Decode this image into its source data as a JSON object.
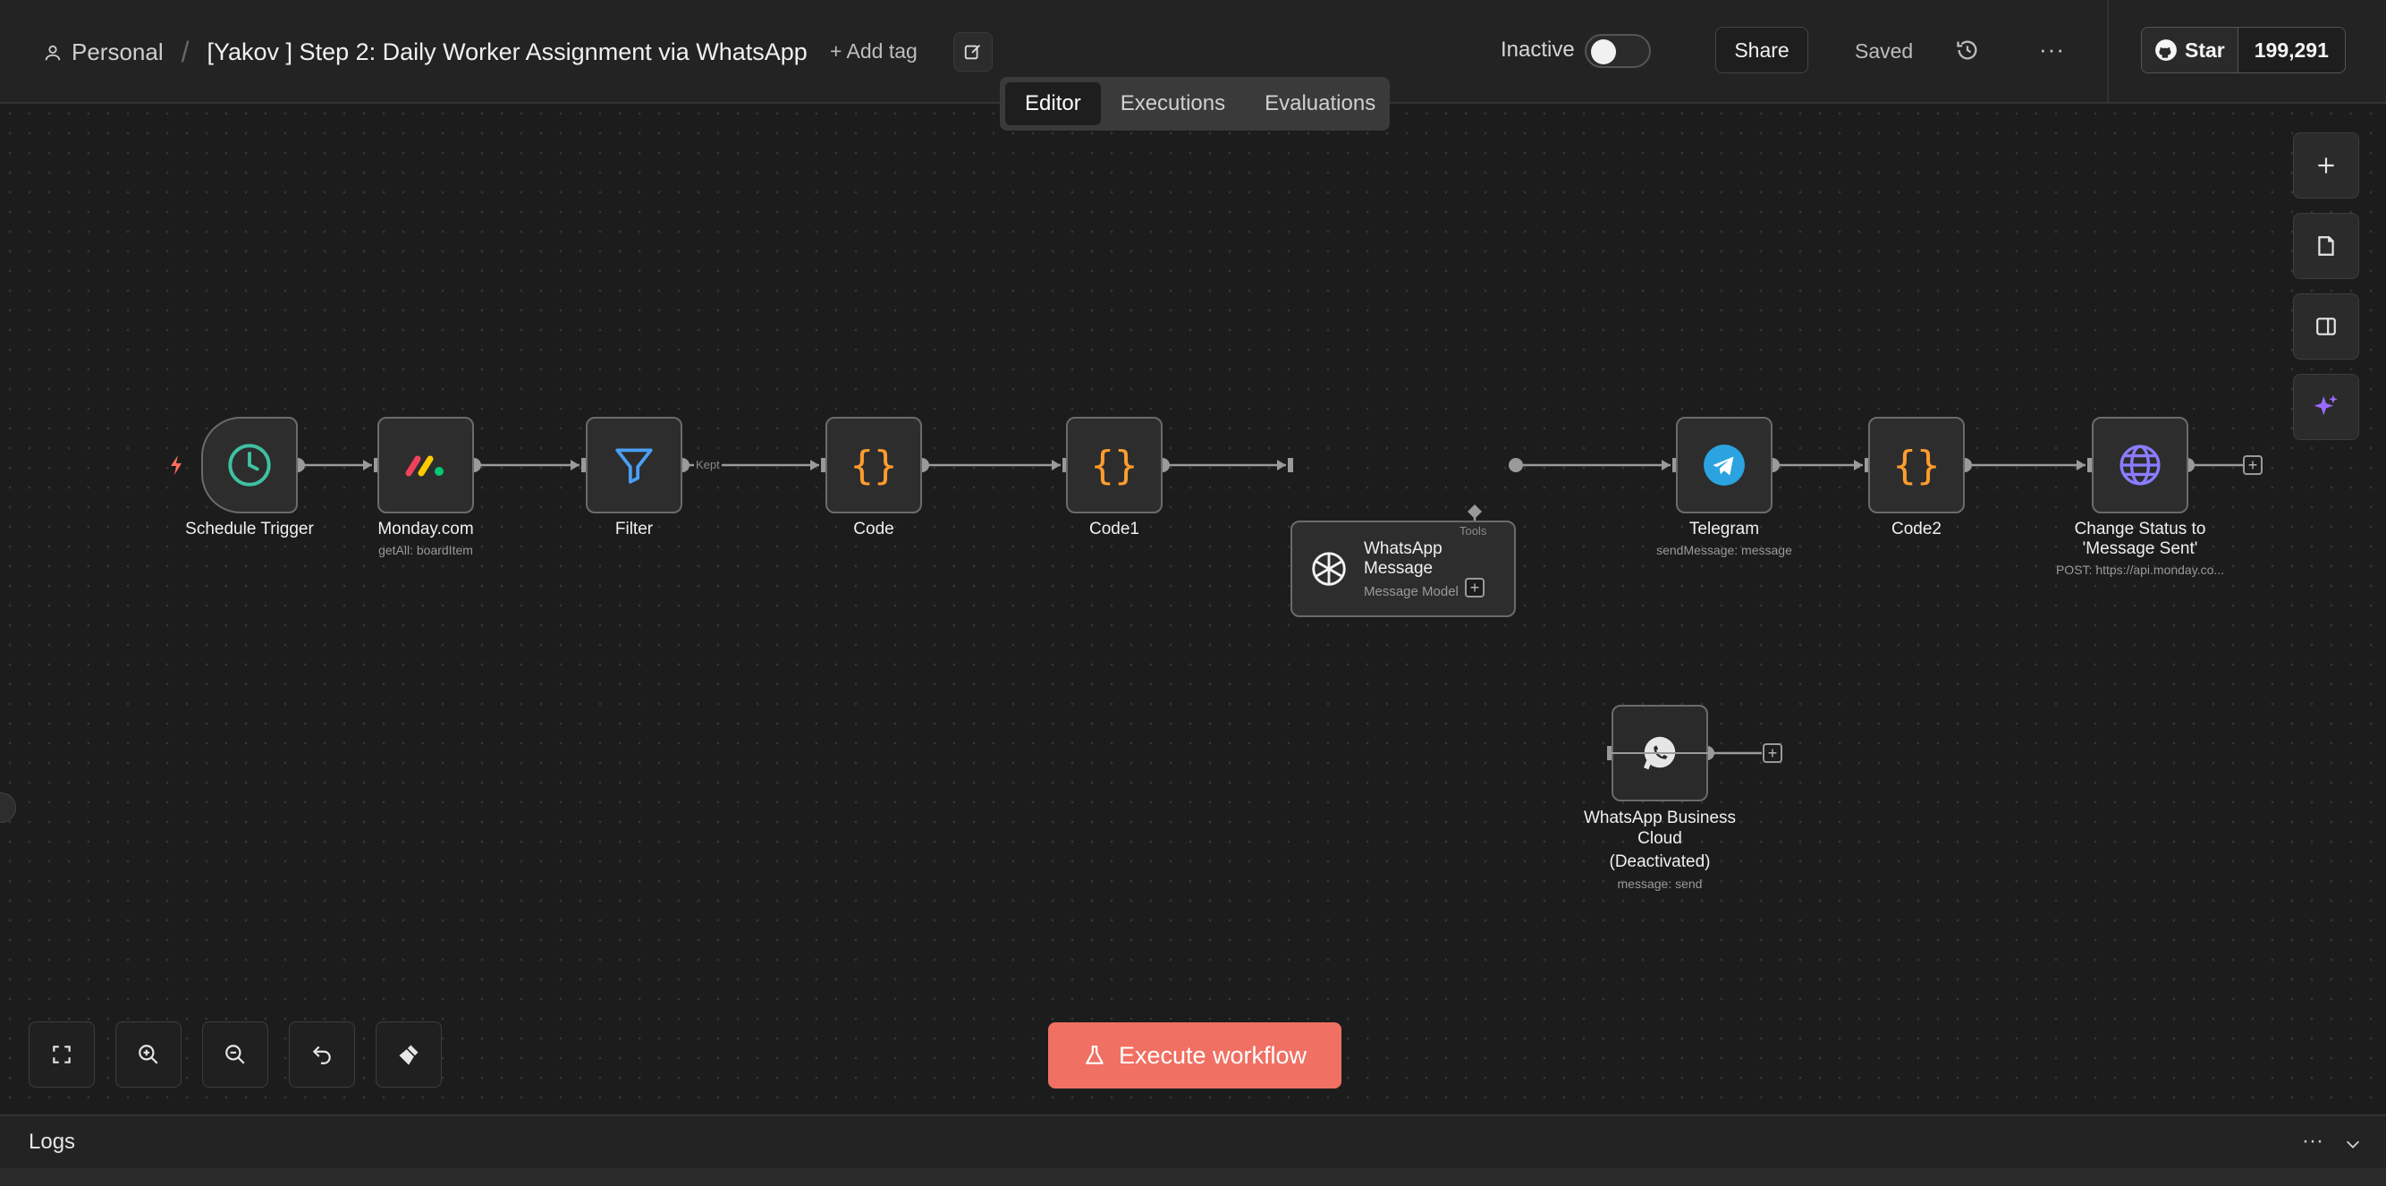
{
  "header": {
    "project": "Personal",
    "workflow_title": "[Yakov ] Step 2: Daily Worker Assignment via WhatsApp",
    "add_tag": "+ Add tag",
    "tabs": [
      {
        "label": "Editor",
        "active": true
      },
      {
        "label": "Executions",
        "active": false
      },
      {
        "label": "Evaluations",
        "active": false
      }
    ],
    "status_label": "Inactive",
    "active": false,
    "share": "Share",
    "saved": "Saved",
    "github_star": "Star",
    "github_count": "199,291"
  },
  "nodes": [
    {
      "id": "schedule",
      "name": "Schedule Trigger",
      "sub": "",
      "icon": "clock-icon"
    },
    {
      "id": "monday",
      "name": "Monday.com",
      "sub": "getAll: boardItem",
      "icon": "monday-logo-icon"
    },
    {
      "id": "filter",
      "name": "Filter",
      "sub": "",
      "icon": "filter-icon"
    },
    {
      "id": "code",
      "name": "Code",
      "sub": "",
      "icon": "code-braces-icon"
    },
    {
      "id": "code1",
      "name": "Code1",
      "sub": "",
      "icon": "code-braces-icon"
    },
    {
      "id": "whatsapp_message",
      "name": "WhatsApp Message",
      "name_line1": "WhatsApp",
      "name_line2": "Message",
      "sub": "Message Model",
      "icon": "openai-icon",
      "port_label": "Tools"
    },
    {
      "id": "telegram",
      "name": "Telegram",
      "sub": "sendMessage: message",
      "icon": "telegram-icon"
    },
    {
      "id": "code2",
      "name": "Code2",
      "sub": "",
      "icon": "code-braces-icon"
    },
    {
      "id": "change_status",
      "name": "Change Status to 'Message Sent'",
      "name_line1": "Change Status to",
      "name_line2": "'Message Sent'",
      "sub": "POST: https://api.monday.co...",
      "icon": "globe-icon"
    },
    {
      "id": "whatsapp_cloud",
      "name": "WhatsApp Business Cloud (Deactivated)",
      "name_line1": "WhatsApp Business",
      "name_line2": "Cloud",
      "name_line3": "(Deactivated)",
      "sub": "message: send",
      "icon": "whatsapp-icon"
    }
  ],
  "edge_labels": {
    "filter_kept": "Kept"
  },
  "actions": {
    "execute_workflow": "Execute workflow"
  },
  "logs": {
    "title": "Logs",
    "more": "···"
  },
  "colors": {
    "execute": "#f07063",
    "canvas": "#1c1c1c",
    "trigger_bolt": "#ff6d5a",
    "ai_sparkle": "#9b6bff"
  }
}
